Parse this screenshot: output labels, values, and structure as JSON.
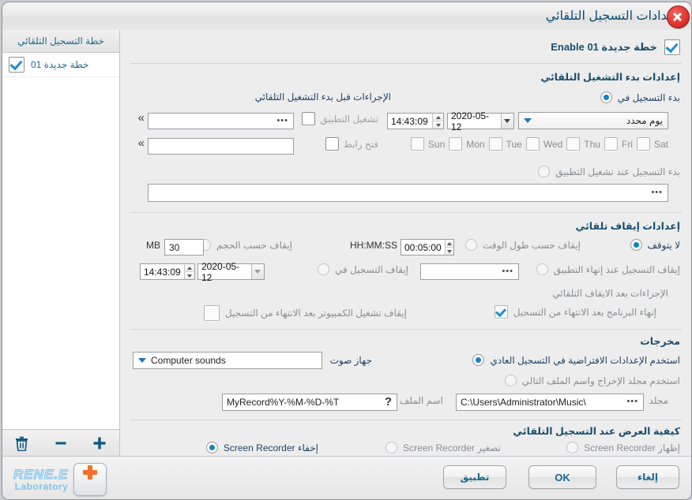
{
  "window": {
    "title": "إعدادات التسجيل التلقائي",
    "close_icon": "close-icon"
  },
  "sidebar": {
    "header": "خطة التسجيل التلقائي",
    "items": [
      {
        "label": "خطة جديدة 01",
        "checked": true
      }
    ],
    "toolbar": {
      "add": "+",
      "remove": "−",
      "delete_icon": "trash-icon"
    }
  },
  "plan": {
    "enable_label": "خطة جديدة Enable 01",
    "enable_checked": true
  },
  "start": {
    "section_title": "إعدادات بدء التشغيل التلقائي",
    "radio_start_at": "بدء التسجيل في",
    "radio_start_at_selected": true,
    "day_mode": "يوم محدد",
    "date": "2020-05-12",
    "time": "14:43:09",
    "days": [
      {
        "label": "Sun",
        "checked": false
      },
      {
        "label": "Mon",
        "checked": false
      },
      {
        "label": "Tue",
        "checked": false
      },
      {
        "label": "Wed",
        "checked": false
      },
      {
        "label": "Thu",
        "checked": false
      },
      {
        "label": "Fri",
        "checked": false
      },
      {
        "label": "Sat",
        "checked": false
      }
    ],
    "pre_actions_title": "الإجراءات قبل بدء التشغيل التلقائي",
    "run_app_label": "تشغيل التطبيق",
    "run_app_checked": false,
    "run_app_value": "",
    "open_link_label": "فتح رابط",
    "open_link_checked": false,
    "open_link_value": "",
    "expand_icon": "chevron-double-icon",
    "browse_icon": "ellipsis-icon",
    "radio_start_on_app": "بدء التسجيل عند تشغيل التطبيق",
    "radio_start_on_app_selected": false,
    "start_app_value": ""
  },
  "stop": {
    "section_title": "إعدادات إيقاف تلقائي",
    "radio_never": "لا يتوقف",
    "radio_never_selected": true,
    "radio_by_duration": "إيقاف حسب طول الوقت",
    "radio_by_duration_selected": false,
    "duration_value": "00:05:00",
    "duration_format": "HH:MM:SS",
    "radio_by_size": "إيقاف حسب الحجم",
    "radio_by_size_selected": false,
    "size_value": "30",
    "size_unit": "MB",
    "radio_on_app_exit": "إيقاف التسجيل عند إنهاء التطبيق",
    "radio_on_app_exit_selected": false,
    "app_exit_value": "",
    "radio_stop_at": "إيقاف التسجيل في",
    "radio_stop_at_selected": false,
    "stop_date": "2020-05-12",
    "stop_time": "14:43:09",
    "post_actions_title": "الإجراءات بعد الايقاف التلقائي",
    "exit_program_label": "إنهاء البرنامج بعد الانتهاء من التسجيل",
    "exit_program_checked": true,
    "shutdown_label": "إيقاف تشغيل الكمبيوتر بعد الانتهاء من التسجيل",
    "shutdown_checked": false
  },
  "outputs": {
    "section_title": "مخرجات",
    "radio_default": "استخدم الإعدادات الافتراضية في التسجيل العادي",
    "radio_default_selected": true,
    "radio_custom": "استخدم مجلد الإخراج واسم الملف التالي",
    "radio_custom_selected": false,
    "audio_device_label": "جهاز صوت",
    "audio_device_value": "Computer sounds",
    "folder_label": "مجلد",
    "folder_value": "C:\\Users\\Administrator\\Music\\",
    "filename_label": "اسم الملف",
    "filename_value": "MyRecord%Y-%M-%D-%T",
    "help_icon": "question-mark-icon",
    "browse_icon": "ellipsis-icon"
  },
  "display": {
    "section_title": "كيفية العرض عند التسجيل التلقائي",
    "options": [
      {
        "label": "إظهار Screen Recorder",
        "selected": false
      },
      {
        "label": "تصغير Screen Recorder",
        "selected": false
      },
      {
        "label": "إخفاء Screen Recorder",
        "selected": true
      }
    ]
  },
  "footer": {
    "logo_line1": "RENE.E",
    "logo_line2": "Laboratory",
    "apply_label": "تطبيق",
    "ok_label": "OK",
    "cancel_label": "إلغاء"
  }
}
